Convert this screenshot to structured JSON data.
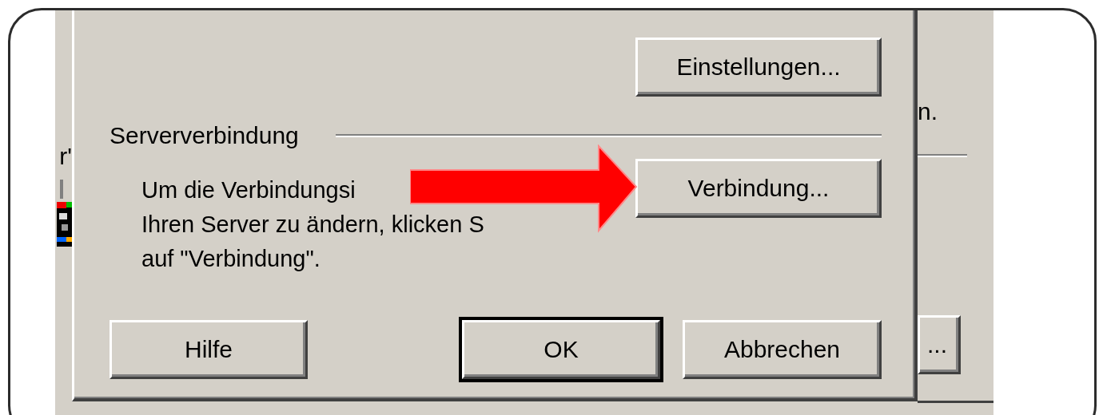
{
  "background_window": {
    "left_fragment": "r'",
    "right_fragment": "n.",
    "right_button": "..."
  },
  "dialog": {
    "top_button": {
      "label": "Einstellungen...",
      "default": false
    },
    "section": {
      "title": "Serververbindung",
      "lines": [
        "Um die Verbindungsi",
        "Ihren Server zu ändern, klicken S",
        "auf \"Verbindung\"."
      ],
      "button": {
        "label": "Verbindung...",
        "default": false
      }
    },
    "buttons": [
      {
        "label": "Hilfe",
        "default": false
      },
      {
        "label": "OK",
        "default": true
      },
      {
        "label": "Abbrechen",
        "default": false
      }
    ]
  }
}
